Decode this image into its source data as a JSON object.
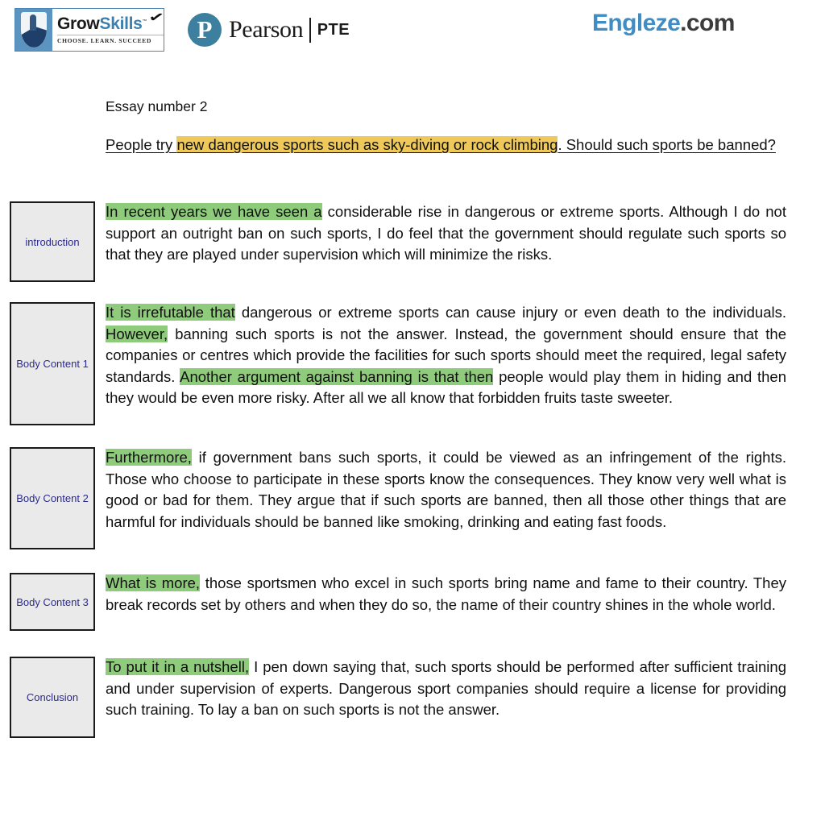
{
  "header": {
    "growskills": {
      "icon": "shield-crest-icon",
      "word_grow": "Grow",
      "word_skills": "Skills",
      "check_icon": "checkmark-icon",
      "trademark": "™",
      "tagline": "CHOOSE.  LEARN.  SUCCEED"
    },
    "pearson": {
      "badge_icon": "pearson-p-icon",
      "badge_letter": "P",
      "name": "Pearson",
      "divider_icon": "vertical-divider-icon",
      "product": "PTE"
    },
    "engleze": {
      "name": "Engleze",
      "tld": ".com",
      "brand_color": "#3f8dc4",
      "tld_color": "#3c3c3c"
    }
  },
  "document": {
    "essay_label": "Essay number 2",
    "prompt": {
      "before_highlight": "People try ",
      "highlight": "new dangerous sports such as sky-diving or rock climbing",
      "after_highlight": ". Should such sports be banned?",
      "highlight_color": "#eec95a"
    },
    "highlight_color_green": "#8ecc7c",
    "tag_text_color": "#2b2b8c",
    "sections": [
      {
        "tag": "introduction",
        "highlight": "In recent years we have seen a",
        "rest": " considerable rise in dangerous or extreme sports. Although I do not support an outright ban on such sports, I do feel that the government should regulate such sports so that they are played under supervision which will minimize the risks."
      },
      {
        "tag": "Body Content 1",
        "highlight": "It is irrefutable that",
        "mid1": " dangerous or extreme sports can cause injury or even death to the individuals. ",
        "highlight2": "However,",
        "mid2": " banning such sports is not the answer. Instead, the government should ensure that the companies or centres which provide the facilities for such sports should meet the required, legal safety standards. ",
        "highlight3": "Another argument against banning is that then",
        "rest": " people would play them in hiding and then they would be even more risky. After all we all know that forbidden fruits taste sweeter."
      },
      {
        "tag": "Body Content 2",
        "highlight": "Furthermore,",
        "rest": " if government bans such sports, it could be viewed as an infringement of the rights. Those who choose to participate in these sports know the consequences. They know very well what is good or bad for them. They argue that if such sports are banned, then all those other things that are harmful for individuals should be banned like smoking, drinking and eating fast foods."
      },
      {
        "tag": "Body Content 3",
        "highlight": "What is more,",
        "rest": " those sportsmen who excel in such sports bring name and fame to their country. They break records set by others and when they do so, the name of their country shines in the whole world."
      },
      {
        "tag": "Conclusion",
        "highlight": "To put it in a nutshell,",
        "rest": " I pen down saying that, such sports should be performed after sufficient training and under supervision of experts. Dangerous sport companies should require a license for providing such training. To lay a ban on such sports is not the answer."
      }
    ]
  }
}
